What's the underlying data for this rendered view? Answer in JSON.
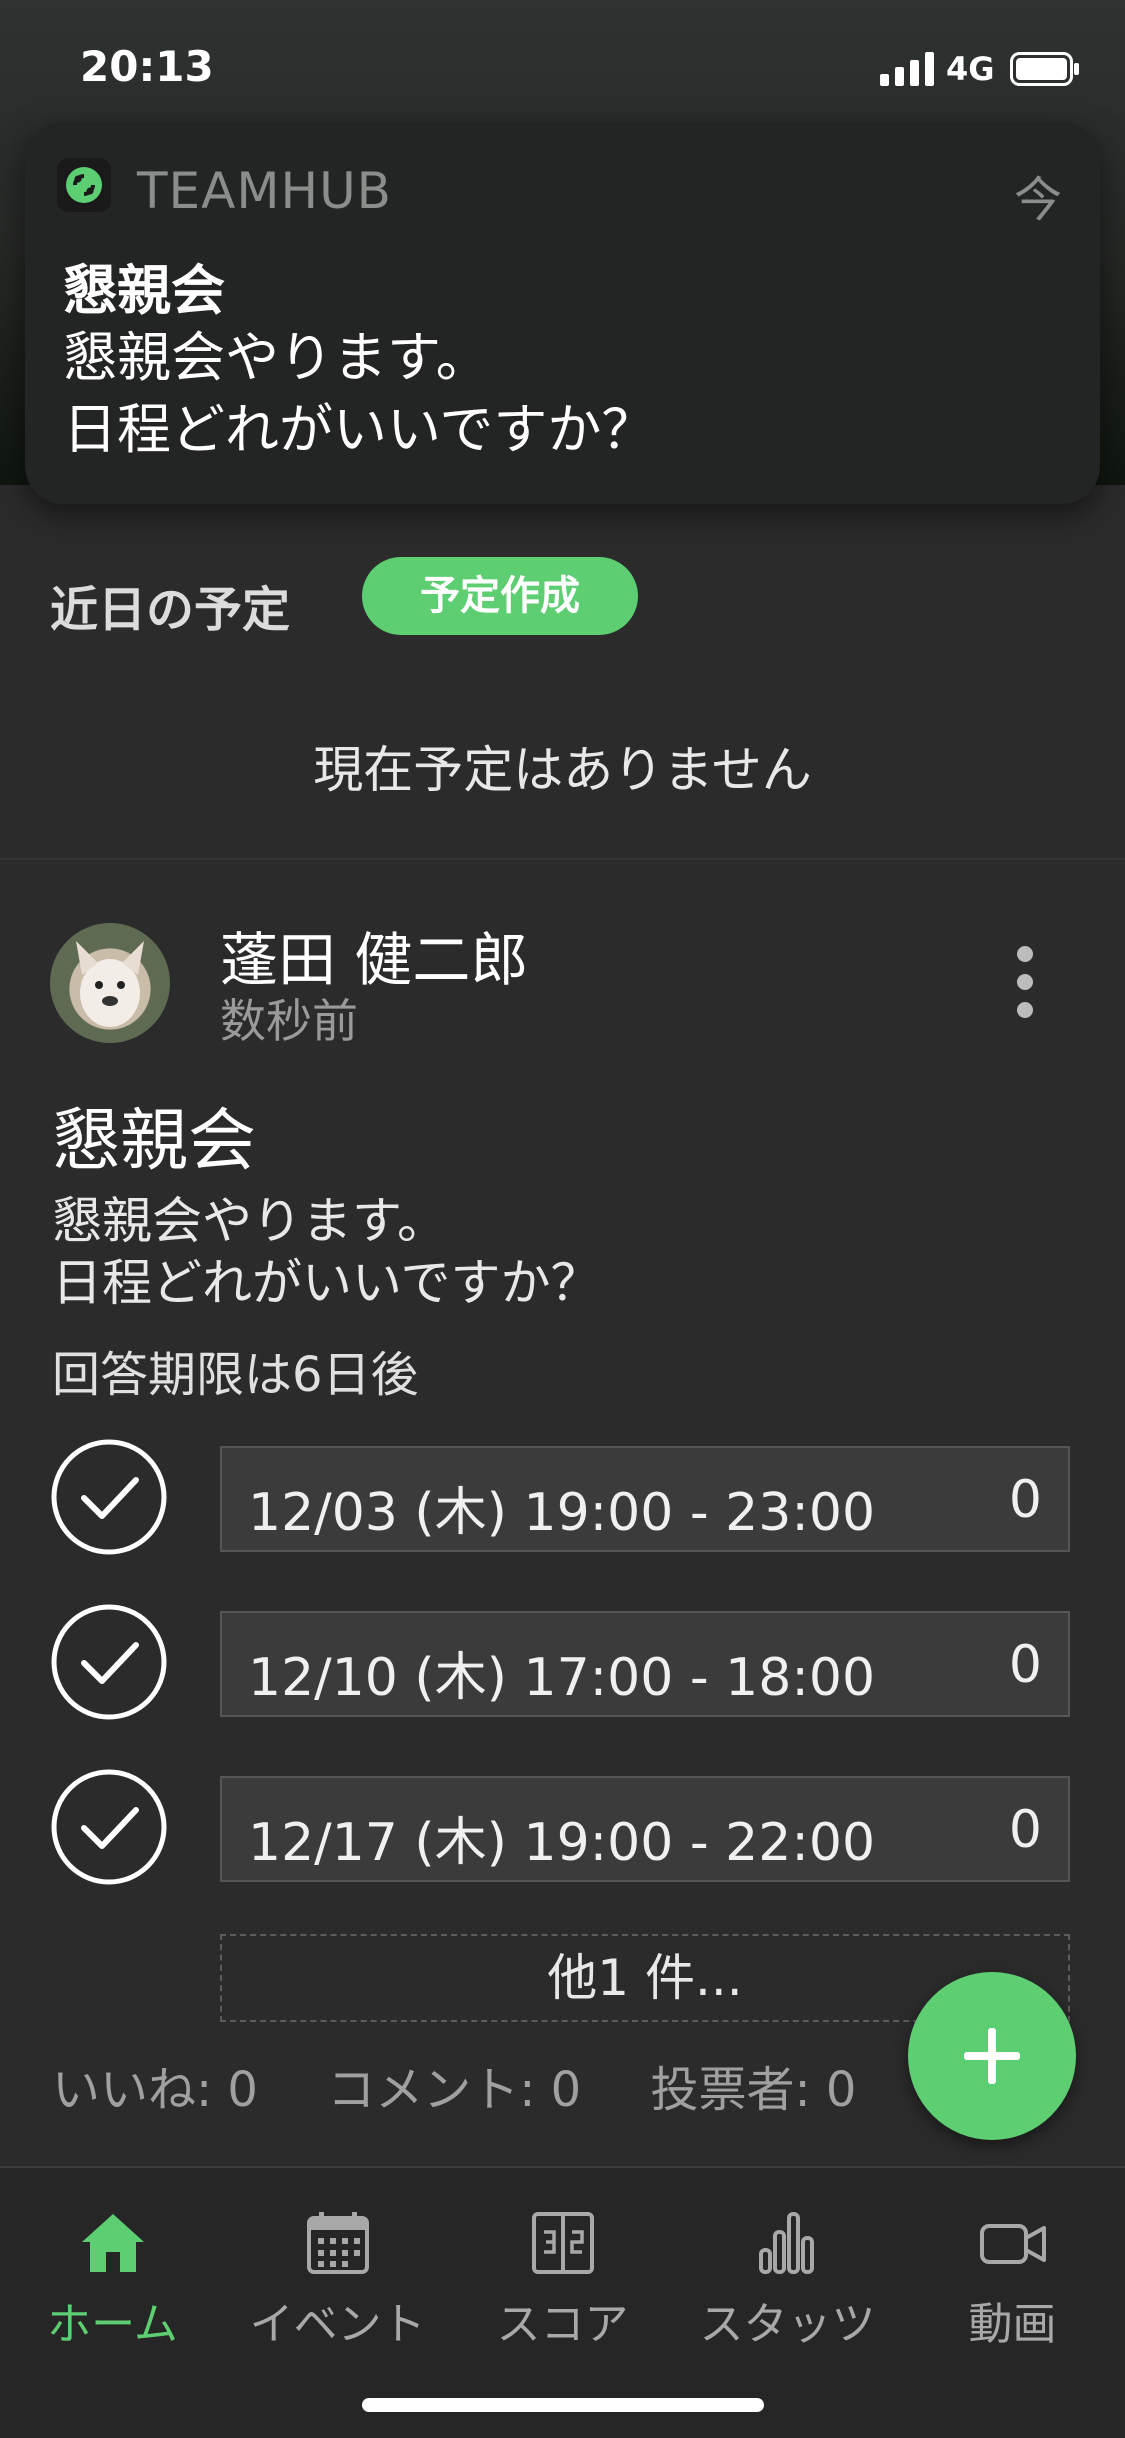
{
  "status_bar": {
    "time": "20:13",
    "network": "4G"
  },
  "notification": {
    "app_name": "TEAMHUB",
    "time": "今",
    "title": "懇親会",
    "body": "懇親会やります。\n日程どれがいいですか？"
  },
  "schedule": {
    "title": "近日の予定",
    "create_button": "予定作成",
    "empty_message": "現在予定はありません"
  },
  "post": {
    "author": "蓬田 健二郎",
    "time": "数秒前",
    "title": "懇親会",
    "body": "懇親会やります。\n日程どれがいいですか？",
    "deadline": "回答期限は6日後",
    "options": [
      {
        "label": "12/03 (木) 19:00 - 23:00",
        "count": "0"
      },
      {
        "label": "12/10 (木) 17:00 - 18:00",
        "count": "0"
      },
      {
        "label": "12/17 (木) 19:00 - 22:00",
        "count": "0"
      }
    ],
    "more_options": "他1 件...",
    "stats": {
      "likes": "いいね: 0",
      "comments": "コメント: 0",
      "voters": "投票者: 0"
    }
  },
  "tabs": [
    {
      "label": "ホーム",
      "icon": "home-icon",
      "active": true
    },
    {
      "label": "イベント",
      "icon": "calendar-icon",
      "active": false
    },
    {
      "label": "スコア",
      "icon": "scoreboard-icon",
      "active": false
    },
    {
      "label": "スタッツ",
      "icon": "stats-icon",
      "active": false
    },
    {
      "label": "動画",
      "icon": "video-icon",
      "active": false
    }
  ],
  "colors": {
    "accent": "#5dcf72",
    "background": "#2b2b2c",
    "tab_bar": "#262626"
  }
}
